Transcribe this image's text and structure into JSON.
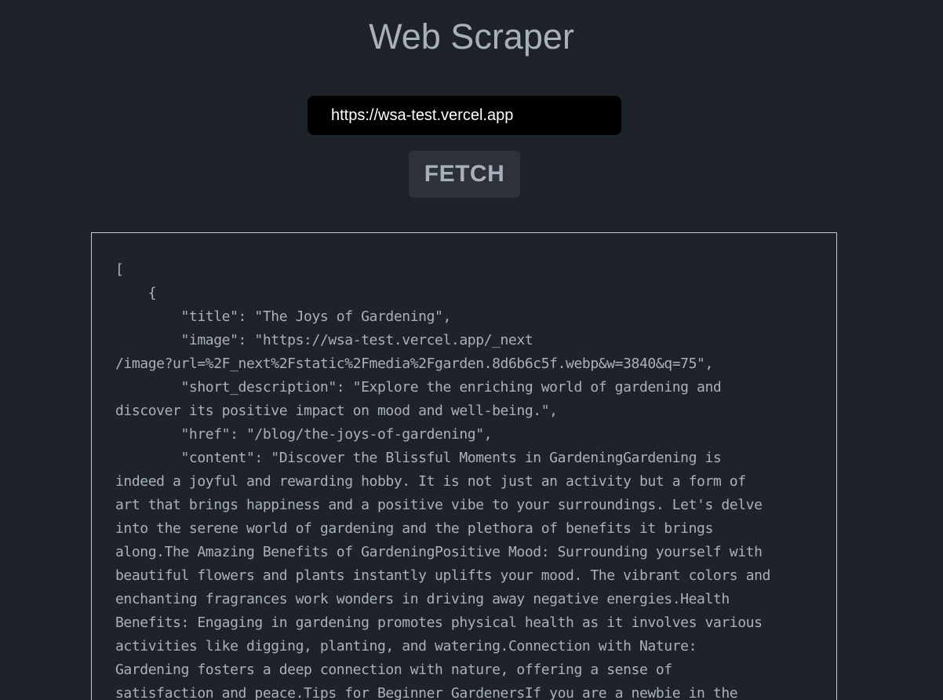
{
  "header": {
    "title": "Web Scraper"
  },
  "form": {
    "url_value": "https://wsa-test.vercel.app",
    "fetch_label": "FETCH"
  },
  "result": {
    "text": "[\n    {\n        \"title\": \"The Joys of Gardening\",\n        \"image\": \"https://wsa-test.vercel.app/_next\n/image?url=%2F_next%2Fstatic%2Fmedia%2Fgarden.8d6b6c5f.webp&w=3840&q=75\",\n        \"short_description\": \"Explore the enriching world of gardening and\ndiscover its positive impact on mood and well-being.\",\n        \"href\": \"/blog/the-joys-of-gardening\",\n        \"content\": \"Discover the Blissful Moments in GardeningGardening is\nindeed a joyful and rewarding hobby. It is not just an activity but a form of\nart that brings happiness and a positive vibe to your surroundings. Let's delve\ninto the serene world of gardening and the plethora of benefits it brings\nalong.The Amazing Benefits of GardeningPositive Mood: Surrounding yourself with\nbeautiful flowers and plants instantly uplifts your mood. The vibrant colors and\nenchanting fragrances work wonders in driving away negative energies.Health\nBenefits: Engaging in gardening promotes physical health as it involves various\nactivities like digging, planting, and watering.Connection with Nature:\nGardening fosters a deep connection with nature, offering a sense of\nsatisfaction and peace.Tips for Beginner GardenersIf you are a newbie in the"
  }
}
